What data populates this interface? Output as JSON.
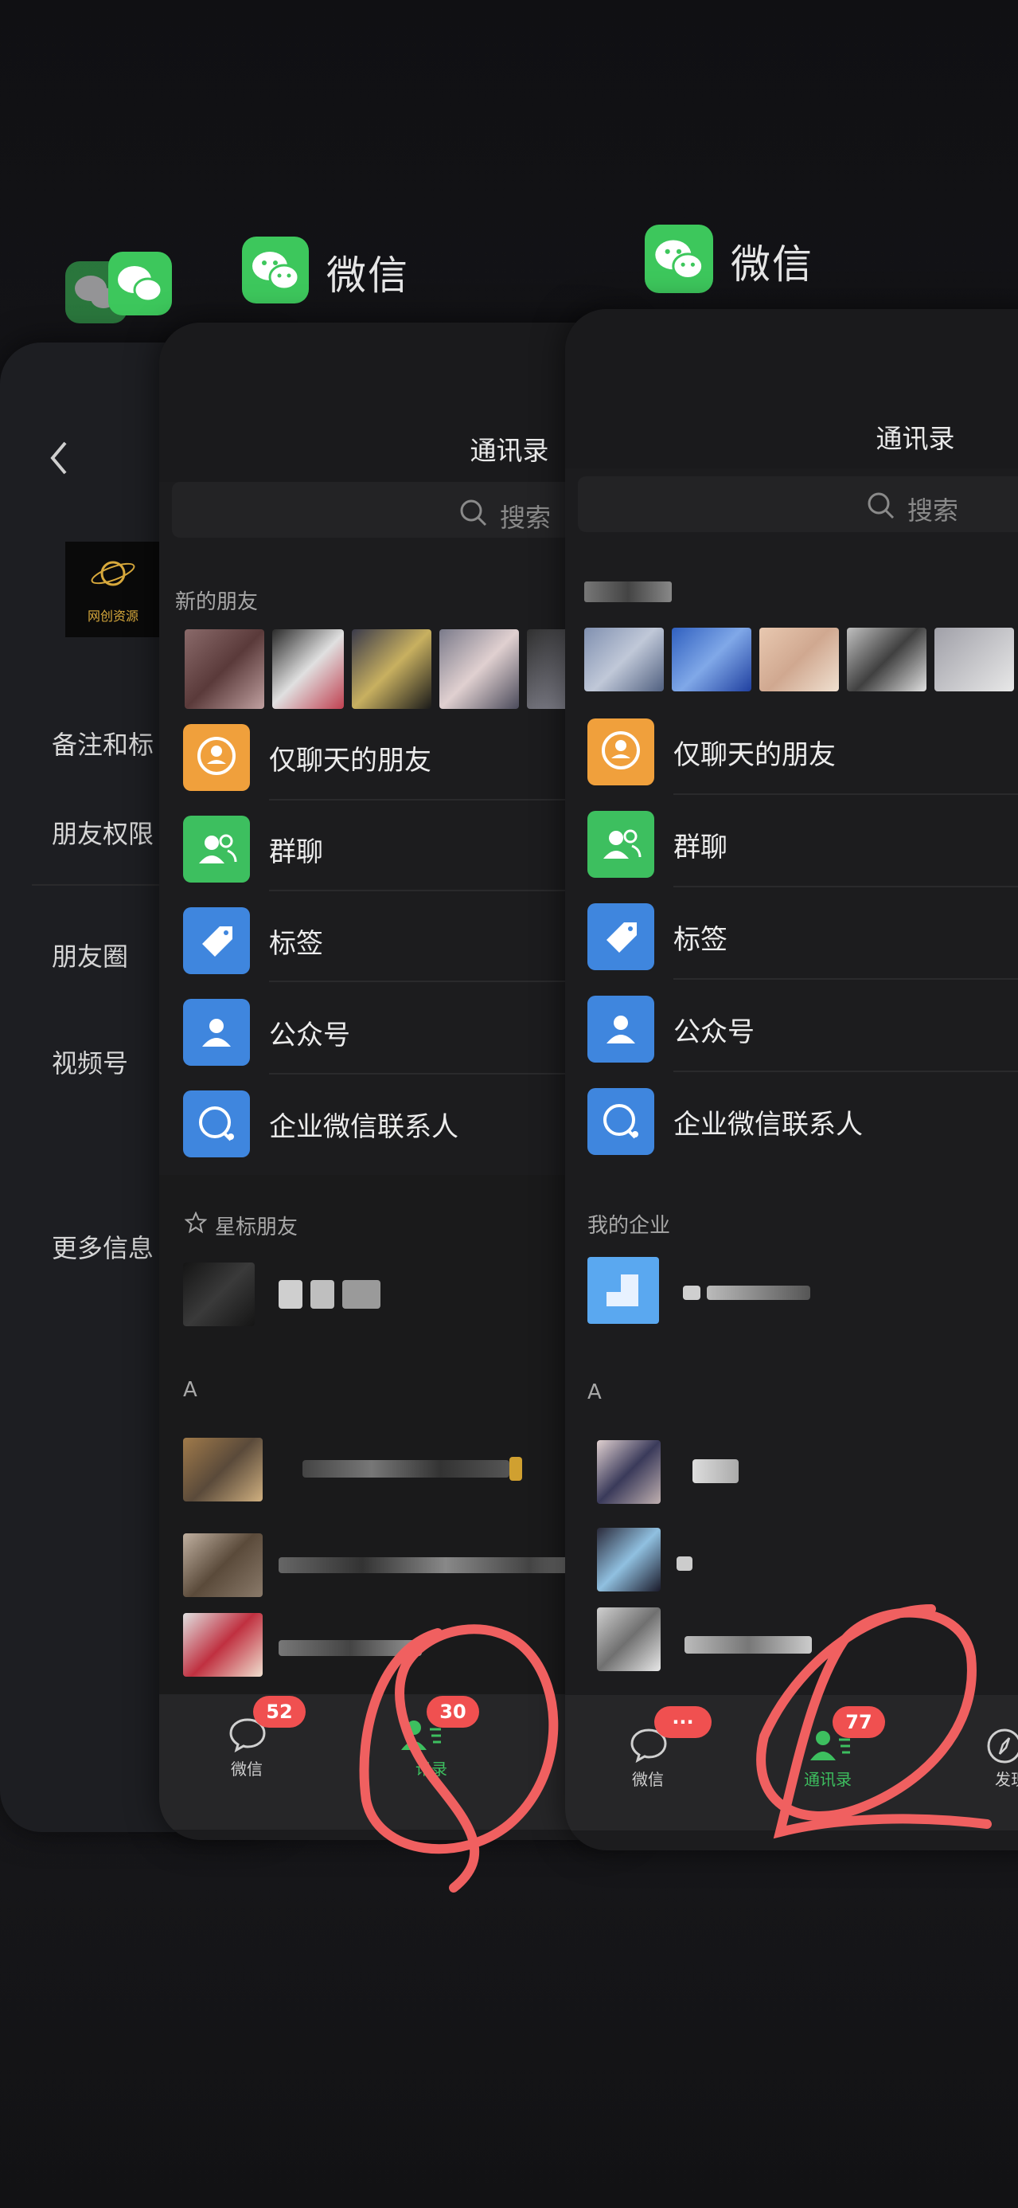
{
  "app": {
    "name": "微信"
  },
  "back_card": {
    "items": [
      "备注和标",
      "朋友权限",
      "朋友圈",
      "视频号",
      "更多信息"
    ],
    "logo_text": "网创资源"
  },
  "card_mid": {
    "title": "通讯录",
    "search_placeholder": "搜索",
    "new_friends_label": "新的朋友",
    "menu": [
      {
        "label": "仅聊天的朋友",
        "icon": "person-chat-icon",
        "color": "#f0a03c"
      },
      {
        "label": "群聊",
        "icon": "group-icon",
        "color": "#3dbf5f"
      },
      {
        "label": "标签",
        "icon": "tag-icon",
        "color": "#3f86de"
      },
      {
        "label": "公众号",
        "icon": "official-account-icon",
        "color": "#3f86de"
      },
      {
        "label": "企业微信联系人",
        "icon": "work-contact-icon",
        "color": "#3f86de"
      }
    ],
    "starred_label": "星标朋友",
    "index_a": "A",
    "tabs": [
      {
        "label": "微信",
        "badge": "52"
      },
      {
        "label": "讯录",
        "badge": "30"
      }
    ]
  },
  "card_front": {
    "title": "通讯录",
    "search_placeholder": "搜索",
    "menu": [
      {
        "label": "仅聊天的朋友",
        "icon": "person-chat-icon",
        "color": "#f0a03c"
      },
      {
        "label": "群聊",
        "icon": "group-icon",
        "color": "#3dbf5f"
      },
      {
        "label": "标签",
        "icon": "tag-icon",
        "color": "#3f86de"
      },
      {
        "label": "公众号",
        "icon": "official-account-icon",
        "color": "#3f86de"
      },
      {
        "label": "企业微信联系人",
        "icon": "work-contact-icon",
        "color": "#3f86de"
      }
    ],
    "enterprise_label": "我的企业",
    "index_a": "A",
    "tabs": [
      {
        "label": "微信",
        "badge": "···"
      },
      {
        "label": "通讯录",
        "badge": "77"
      },
      {
        "label": "发现",
        "badge": ""
      }
    ]
  },
  "colors": {
    "wechat_green": "#3dc75c",
    "active_tab": "#3dbf5f",
    "badge_red": "#f05050",
    "annotation": "#f06060"
  }
}
